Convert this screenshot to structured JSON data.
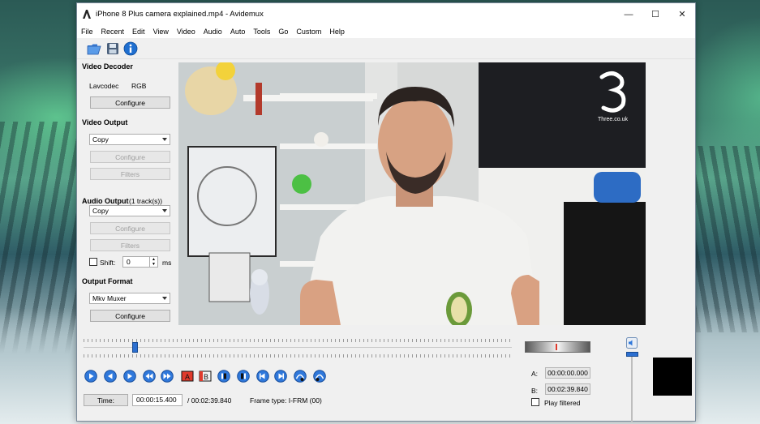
{
  "window": {
    "title": "iPhone 8 Plus camera explained.mp4 - Avidemux"
  },
  "titlebar_controls": {
    "minimize": "—",
    "maximize": "☐",
    "close": "✕"
  },
  "menu": [
    "File",
    "Recent",
    "Edit",
    "View",
    "Video",
    "Audio",
    "Auto",
    "Tools",
    "Go",
    "Custom",
    "Help"
  ],
  "toolbar": {
    "icons": [
      "open-icon",
      "save-icon",
      "info-icon"
    ]
  },
  "video_decoder": {
    "heading": "Video Decoder",
    "codec": "Lavcodec",
    "format": "RGB",
    "configure": "Configure"
  },
  "video_output": {
    "heading": "Video Output",
    "selected": "Copy",
    "configure": "Configure",
    "filters": "Filters"
  },
  "audio_output": {
    "heading": "Audio Output",
    "tracks": "(1 track(s))",
    "selected": "Copy",
    "configure": "Configure",
    "filters": "Filters",
    "shift_label": "Shift:",
    "shift_value": "0",
    "shift_unit": "ms"
  },
  "output_format": {
    "heading": "Output Format",
    "selected": "Mkv Muxer",
    "configure": "Configure"
  },
  "video_overlay": {
    "logo_text": "Three.co.uk"
  },
  "timeline": {
    "position_fraction": 0.12
  },
  "playback": {
    "time_button": "Time:",
    "current_time": "00:00:15.400",
    "total_time": "/ 00:02:39.840",
    "frame_type": "Frame type:  I-FRM (00)"
  },
  "markers": {
    "a_label": "A:",
    "a_value": "00:00:00.000",
    "b_label": "B:",
    "b_value": "00:02:39.840",
    "play_filtered": "Play filtered"
  },
  "controls": [
    "play",
    "rewind",
    "fast-forward",
    "prev-keyframe",
    "next-keyframe",
    "set-marker-a",
    "set-marker-b",
    "prev-cut",
    "next-cut",
    "goto-marker-a",
    "goto-marker-b",
    "goto-start",
    "goto-end"
  ],
  "colors": {
    "accent_blue": "#2c6fd0",
    "marker_red": "#e03a2c"
  }
}
